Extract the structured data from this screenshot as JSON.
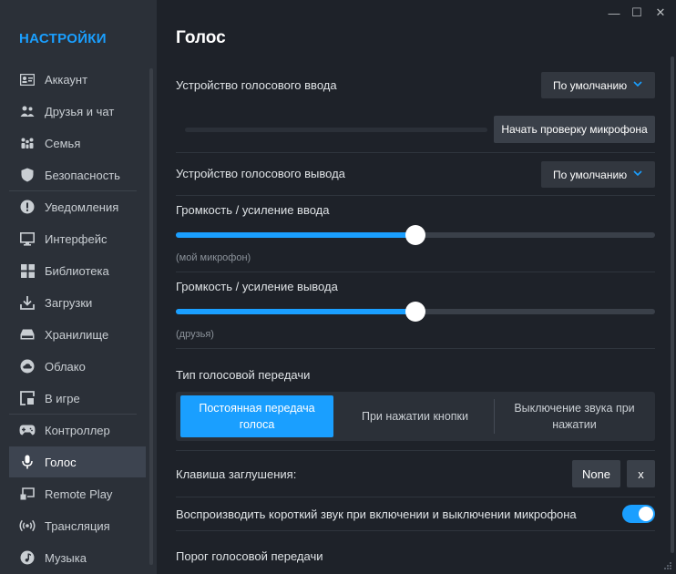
{
  "sidebar": {
    "title": "НАСТРОЙКИ",
    "items": [
      {
        "label": "Аккаунт",
        "icon": "account-card-icon"
      },
      {
        "label": "Друзья и чат",
        "icon": "friends-icon"
      },
      {
        "label": "Семья",
        "icon": "family-icon"
      },
      {
        "label": "Безопасность",
        "icon": "shield-icon"
      },
      {
        "label": "Уведомления",
        "icon": "alert-icon"
      },
      {
        "label": "Интерфейс",
        "icon": "monitor-icon"
      },
      {
        "label": "Библиотека",
        "icon": "grid-icon"
      },
      {
        "label": "Загрузки",
        "icon": "download-icon"
      },
      {
        "label": "Хранилище",
        "icon": "drive-icon"
      },
      {
        "label": "Облако",
        "icon": "cloud-icon"
      },
      {
        "label": "В игре",
        "icon": "ingame-icon"
      },
      {
        "label": "Контроллер",
        "icon": "gamepad-icon"
      },
      {
        "label": "Голос",
        "icon": "microphone-icon",
        "active": true
      },
      {
        "label": "Remote Play",
        "icon": "remote-play-icon"
      },
      {
        "label": "Трансляция",
        "icon": "broadcast-icon"
      },
      {
        "label": "Музыка",
        "icon": "music-icon"
      }
    ]
  },
  "window": {
    "minimize": "—",
    "maximize": "☐",
    "close": "✕"
  },
  "main": {
    "title": "Голос",
    "input_device": {
      "label": "Устройство голосового ввода",
      "value": "По умолчанию"
    },
    "mic_test": {
      "button": "Начать проверку микрофона",
      "level": 0
    },
    "output_device": {
      "label": "Устройство голосового вывода",
      "value": "По умолчанию"
    },
    "input_volume": {
      "label": "Громкость / усиление ввода",
      "sublabel": "(мой микрофон)",
      "value": 0.5
    },
    "output_volume": {
      "label": "Громкость / усиление вывода",
      "sublabel": "(друзья)",
      "value": 0.5
    },
    "transmission": {
      "label": "Тип голосовой передачи",
      "options": [
        {
          "line1": "Постоянная передача",
          "line2": "голоса",
          "active": true
        },
        {
          "line1": "При нажатии кнопки",
          "line2": ""
        },
        {
          "line1": "Выключение звука при",
          "line2": "нажатии"
        }
      ]
    },
    "mute_key": {
      "label": "Клавиша заглушения:",
      "value": "None",
      "clear": "x"
    },
    "sound_toggle": {
      "label": "Воспроизводить короткий звук при включении и выключении микрофона",
      "on": true
    },
    "threshold": {
      "label": "Порог голосовой передачи"
    }
  },
  "colors": {
    "accent": "#1a9fff",
    "background": "#1e2229",
    "sidebar": "#2b3038"
  }
}
